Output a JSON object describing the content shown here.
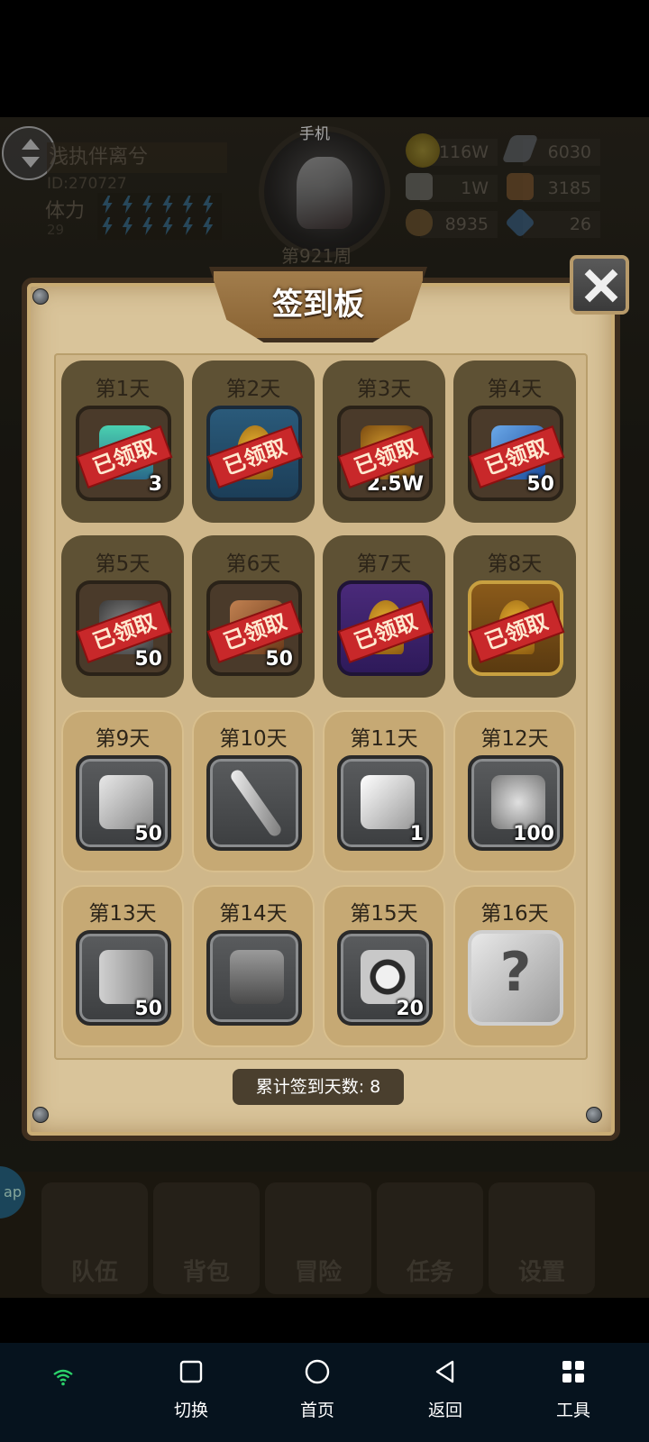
{
  "header": {
    "player_name": "浅执伴离兮",
    "player_id": "ID:270727",
    "stamina_label": "体力",
    "stamina_value": "29",
    "phone_label": "手机",
    "week_label": "第921周",
    "resources": {
      "gold": "116W",
      "iron": "6030",
      "stone": "1W",
      "leather": "3185",
      "wood": "8935",
      "gem": "26"
    }
  },
  "dialog": {
    "title": "签到板",
    "total_label": "累计签到天数: 8",
    "stamp_text": "已领取",
    "days": [
      {
        "label": "第1天",
        "qty": "3",
        "claimed": true,
        "item": "potion-icon",
        "frame": "brown"
      },
      {
        "label": "第2天",
        "qty": "",
        "claimed": true,
        "item": "mystery-box-icon",
        "frame": "blue"
      },
      {
        "label": "第3天",
        "qty": "2.5W",
        "claimed": true,
        "item": "gold-bag-icon",
        "frame": "brown"
      },
      {
        "label": "第4天",
        "qty": "50",
        "claimed": true,
        "item": "crystal-icon",
        "frame": "brown"
      },
      {
        "label": "第5天",
        "qty": "50",
        "claimed": true,
        "item": "ore-icon",
        "frame": "brown"
      },
      {
        "label": "第6天",
        "qty": "50",
        "claimed": true,
        "item": "leather-icon",
        "frame": "brown"
      },
      {
        "label": "第7天",
        "qty": "",
        "claimed": true,
        "item": "mystery-box-icon",
        "frame": "purple"
      },
      {
        "label": "第8天",
        "qty": "",
        "claimed": true,
        "item": "mystery-box-icon",
        "frame": "gold"
      },
      {
        "label": "第9天",
        "qty": "50",
        "claimed": false,
        "item": "iron-ingot-icon",
        "frame": "gray"
      },
      {
        "label": "第10天",
        "qty": "",
        "claimed": false,
        "item": "sword-icon",
        "frame": "gray"
      },
      {
        "label": "第11天",
        "qty": "1",
        "claimed": false,
        "item": "feather-icon",
        "frame": "gray"
      },
      {
        "label": "第12天",
        "qty": "100",
        "claimed": false,
        "item": "stone-icon",
        "frame": "gray"
      },
      {
        "label": "第13天",
        "qty": "50",
        "claimed": false,
        "item": "log-icon",
        "frame": "gray"
      },
      {
        "label": "第14天",
        "qty": "",
        "claimed": false,
        "item": "backpack-icon",
        "frame": "gray"
      },
      {
        "label": "第15天",
        "qty": "20",
        "claimed": false,
        "item": "emblem-icon",
        "frame": "gray"
      },
      {
        "label": "第16天",
        "qty": "",
        "claimed": false,
        "item": "question-icon",
        "frame": "silver"
      }
    ]
  },
  "game_nav": {
    "team": "队伍",
    "bag": "背包",
    "adventure": "冒险",
    "quest": "任务",
    "settings": "设置",
    "side_tab": "ap"
  },
  "system_nav": {
    "switch": "切换",
    "home": "首页",
    "back": "返回",
    "tools": "工具"
  },
  "colors": {
    "claimed_card": "#5e5134",
    "open_card": "#c6a974",
    "stamp": "#c8282a",
    "parchment": "#d9c49a"
  }
}
